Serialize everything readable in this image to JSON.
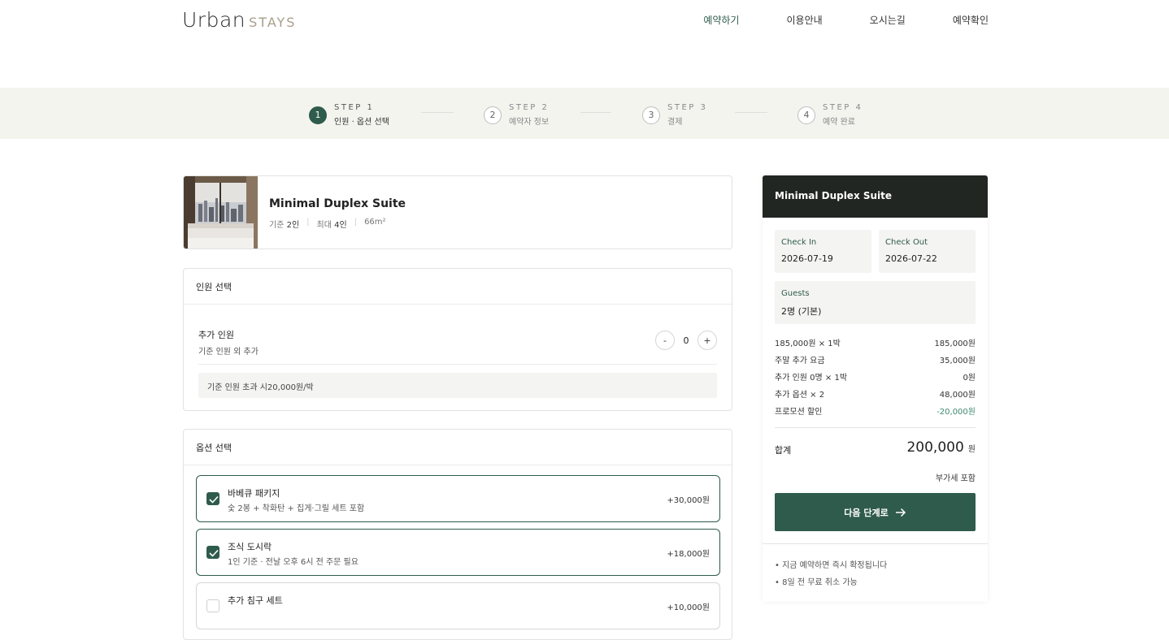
{
  "brand": {
    "name_main": "Urban",
    "name_sub": "STAYS"
  },
  "nav": [
    {
      "label": "예약하기"
    },
    {
      "label": "이용안내"
    },
    {
      "label": "오시는길"
    },
    {
      "label": "예약확인"
    }
  ],
  "steps": [
    {
      "number": "1",
      "label": "STEP 1",
      "name": "인원 · 옵션 선택",
      "active": true
    },
    {
      "number": "2",
      "label": "STEP 2",
      "name": "예약자 정보",
      "active": false
    },
    {
      "number": "3",
      "label": "STEP 3",
      "name": "결제",
      "active": false
    },
    {
      "number": "4",
      "label": "STEP 4",
      "name": "예약 완료",
      "active": false
    }
  ],
  "room": {
    "title": "Minimal Duplex Suite",
    "base_label": "기준",
    "base_value": "2인",
    "max_label": "최대",
    "max_value": "4인",
    "area": "66m²"
  },
  "guests": {
    "section_title": "인원 선택",
    "extra_title": "추가 인원",
    "extra_sub": "기준 인원 외 추가",
    "minus": "-",
    "count": "0",
    "plus": "+",
    "notice": "기준 인원 초과 시20,000원/박"
  },
  "options": {
    "section_title": "옵션 선택",
    "items": [
      {
        "name": "바베큐 패키지",
        "desc": "숯 2봉 + 착화탄 + 집게·그릴 세트 포함",
        "price": "+30,000원",
        "checked": true
      },
      {
        "name": "조식 도시락",
        "desc": "1인 기준 · 전날 오후 6시 전 주문 필요",
        "price": "+18,000원",
        "checked": true
      },
      {
        "name": "추가 침구 세트",
        "desc": "",
        "price": "+10,000원",
        "checked": false
      }
    ]
  },
  "summary": {
    "title": "Minimal Duplex Suite",
    "checkin_label": "Check In",
    "checkin_value": "2026-07-19",
    "checkout_label": "Check Out",
    "checkout_value": "2026-07-22",
    "guests_label": "Guests",
    "guests_value": "2명 (기본)",
    "rows": [
      {
        "label": "185,000원 × 1박",
        "value": "185,000원"
      },
      {
        "label": "주말 추가 요금",
        "value": "35,000원"
      },
      {
        "label": "추가 인원 0명 × 1박",
        "value": "0원"
      },
      {
        "label": "추가 옵션 × 2",
        "value": "48,000원"
      },
      {
        "label": "프로모션 할인",
        "value": "-20,000원"
      }
    ],
    "total_label": "합계",
    "total_value": "200,000",
    "total_unit": "원",
    "vat": "부가세 포함",
    "next_button": "다음 단계로",
    "notes": [
      "• 지금 예약하면 즉시 확정됩니다",
      "• 8일 전 무료 취소 가능"
    ]
  },
  "colors": {
    "accent": "#2f5b4c",
    "dark": "#222623",
    "discount": "#3d8a6e",
    "stepbar": "#f4f4ef"
  }
}
